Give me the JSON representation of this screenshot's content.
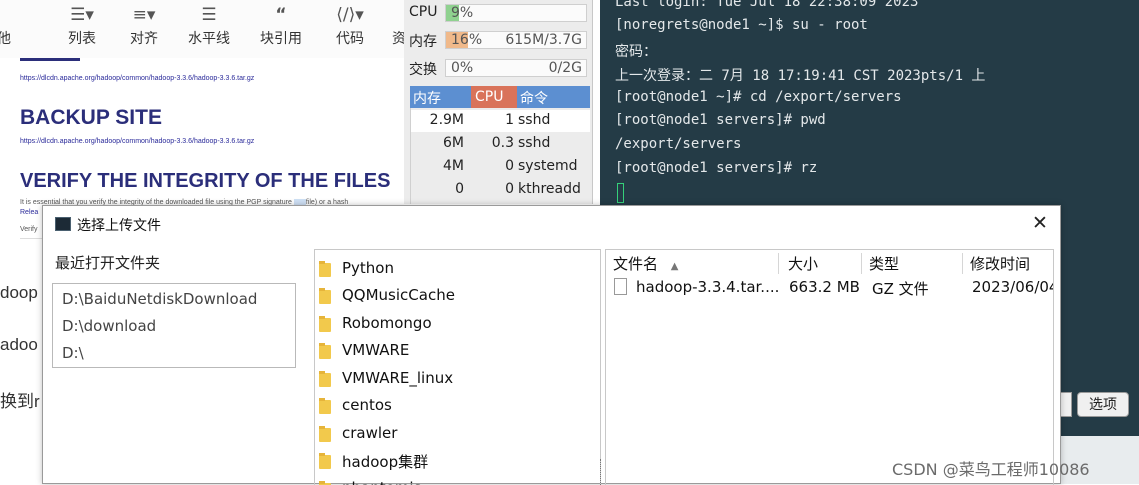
{
  "toolbar": {
    "items": [
      {
        "icon": "ordered-list-icon",
        "label": "他"
      },
      {
        "icon": "unordered-list-icon",
        "label": "列表"
      },
      {
        "icon": "align-icon",
        "label": "对齐"
      },
      {
        "icon": "horizontal-rule-icon",
        "label": "水平线"
      },
      {
        "icon": "quote-icon",
        "label": "块引用"
      },
      {
        "icon": "code-icon",
        "label": "代码"
      },
      {
        "icon": "resource-icon",
        "label": "资"
      }
    ]
  },
  "webpage": {
    "link1": "https://dlcdn.apache.org/hadoop/common/hadoop-3.3.6/hadoop-3.3.6.tar.gz",
    "backup_heading": "BACKUP SITE",
    "link2": "https://dlcdn.apache.org/hadoop/common/hadoop-3.3.6/hadoop-3.3.6.tar.gz",
    "verify_heading": "VERIFY THE INTEGRITY OF THE FILES",
    "verify_text": "It is essential that you verify the integrity of the downloaded file using the PGP signature",
    "verify_text2": "file) or a hash",
    "release_text": "Relea",
    "verify_short": "Verify",
    "side_text_1": "doop",
    "side_text_2": "adoo",
    "side_text_3": "换到r"
  },
  "htop": {
    "cpu_label": "CPU",
    "cpu_value": "9%",
    "cpu_fraction": 0.09,
    "mem_label": "内存",
    "mem_percent": "16%",
    "mem_value": "615M/3.7G",
    "mem_fraction": 0.16,
    "swap_label": "交换",
    "swap_percent": "0%",
    "swap_value": "0/2G",
    "columns": [
      "内存",
      "CPU",
      "命令"
    ],
    "processes": [
      {
        "mem": "2.9M",
        "cpu": "1",
        "cmd": "sshd"
      },
      {
        "mem": "6M",
        "cpu": "0.3",
        "cmd": "sshd"
      },
      {
        "mem": "4M",
        "cpu": "0",
        "cmd": "systemd"
      },
      {
        "mem": "0",
        "cpu": "0",
        "cmd": "kthreadd"
      }
    ]
  },
  "terminal": {
    "lines": [
      "Last login: Tue Jul 18 22:38:09 2023",
      "[noregrets@node1 ~]$ su - root",
      "密码：",
      "上一次登录：二 7月 18 17:19:41 CST 2023pts/1 上",
      "[root@node1 ~]# cd /export/servers",
      "[root@node1 servers]# pwd",
      "/export/servers",
      "[root@node1 servers]# rz"
    ]
  },
  "dialog": {
    "title": "选择上传文件",
    "recent_label": "最近打开文件夹",
    "recent_items": [
      "D:\\BaiduNetdiskDownload",
      "D:\\download",
      "D:\\"
    ],
    "folders": [
      "Python",
      "QQMusicCache",
      "Robomongo",
      "VMWARE",
      "VMWARE_linux",
      "centos",
      "crawler",
      "hadoop集群",
      "phantomjs"
    ],
    "file_columns": [
      "文件名",
      "大小",
      "类型",
      "修改时间"
    ],
    "files": [
      {
        "name": "hadoop-3.3.4.tar....",
        "size": "663.2 MB",
        "type": "GZ 文件",
        "modified": "2023/06/04"
      }
    ]
  },
  "buttons": {
    "left_partial": "",
    "options": "选项"
  },
  "watermark": "CSDN @菜鸟工程师10086",
  "colors": {
    "terminal_bg": "#243b46",
    "htop_header": "#5c8fd1",
    "cpu_bar": "#8fd18f",
    "mem_bar": "#f0b98a"
  }
}
